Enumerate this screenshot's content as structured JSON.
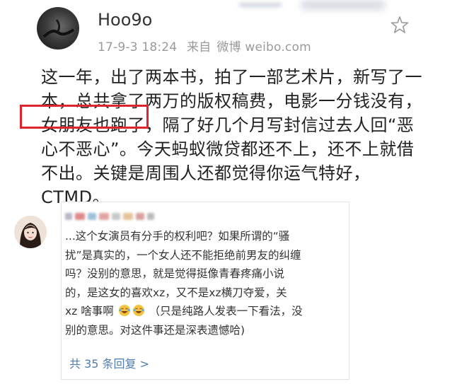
{
  "post": {
    "username": "Hoo9o",
    "date": "17-9-3 18:24",
    "source_prefix": "来自",
    "source_name": "微博 weibo.com",
    "body_lines": [
      "这一年，出了两本书，拍了一部艺术片，新写了一",
      "本，总共拿了两万的版权稿费，电影一分钱没有，",
      "女朋友也跑了，隔了好几个月写封信过去人回“恶",
      "心不恶心”。今天蚂蚁微贷都还不上，还不上就借",
      "不出。关键是周围人还都觉得你运气特好，",
      "CTMD。"
    ],
    "highlighted_text": "女朋友也跑了",
    "highlight_color": "#e0242b"
  },
  "comment": {
    "lines": [
      "...这个女演员有分手的权利吧？如果所谓的“骚",
      "扰”是真实的，一个女人还不能拒绝前男友的纠缠",
      "吗？没别的意思，就是觉得挺像青春疼痛小说",
      "的，是这女的喜欢xz，又不是xz横刀夺爱，关"
    ],
    "line5_before": "xz 啥事啊",
    "line5_after": "（只是纯路人发表一下看法，没",
    "line6": "别的意思。对这件事还是深表遗憾哈)",
    "emoji": "laughing-tears-emoji",
    "reply_link": "共 35 条回复 >",
    "link_color": "#507daf"
  }
}
